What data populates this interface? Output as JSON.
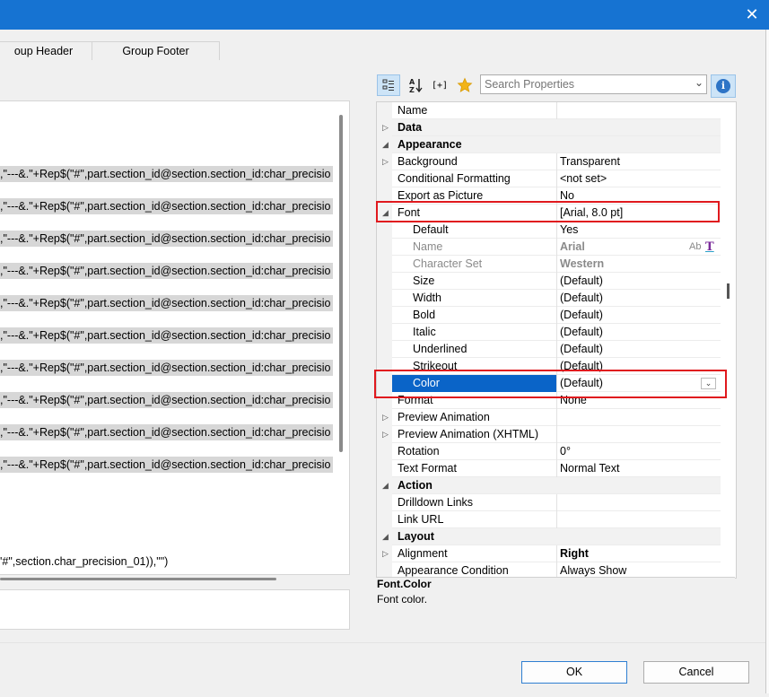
{
  "window": {
    "close_glyph": "✕"
  },
  "tabs": [
    {
      "label": "oup Header"
    },
    {
      "label": "Group Footer"
    }
  ],
  "editor": {
    "lines": [
      ",\"---&.\"+Rep$(\"#\",part.section_id@section.section_id:char_precisio",
      ",\"---&.\"+Rep$(\"#\",part.section_id@section.section_id:char_precisio",
      ",\"---&.\"+Rep$(\"#\",part.section_id@section.section_id:char_precisio",
      ",\"---&.\"+Rep$(\"#\",part.section_id@section.section_id:char_precisio",
      ",\"---&.\"+Rep$(\"#\",part.section_id@section.section_id:char_precisio",
      ",\"---&.\"+Rep$(\"#\",part.section_id@section.section_id:char_precisio",
      ",\"---&.\"+Rep$(\"#\",part.section_id@section.section_id:char_precisio",
      ",\"---&.\"+Rep$(\"#\",part.section_id@section.section_id:char_precisio",
      ",\"---&.\"+Rep$(\"#\",part.section_id@section.section_id:char_precisio",
      ",\"---&.\"+Rep$(\"#\",part.section_id@section.section_id:char_precisio"
    ],
    "last_line": "'#\",section.char_precision_01)),\"\")"
  },
  "toolbar": {
    "search_placeholder": "Search Properties",
    "info_glyph": "i",
    "expr_label": "[+]"
  },
  "properties": [
    {
      "type": "prop",
      "name": "Name",
      "value": ""
    },
    {
      "type": "cat",
      "name": "Data",
      "expander": "▷"
    },
    {
      "type": "cat",
      "name": "Appearance",
      "expander": "◢"
    },
    {
      "type": "prop",
      "name": "Background",
      "value": "Transparent",
      "expander": "▷"
    },
    {
      "type": "prop",
      "name": "Conditional Formatting",
      "value": "<not set>"
    },
    {
      "type": "prop",
      "name": "Export as Picture",
      "value": "No"
    },
    {
      "type": "prop",
      "name": "Font",
      "value": "[Arial, 8.0 pt]",
      "expander": "◢"
    },
    {
      "type": "sub",
      "name": "Default",
      "value": "Yes"
    },
    {
      "type": "subgrey",
      "name": "Name",
      "value": "Arial"
    },
    {
      "type": "subgrey",
      "name": "Character Set",
      "value": "Western"
    },
    {
      "type": "sub",
      "name": "Size",
      "value": "(Default)"
    },
    {
      "type": "sub",
      "name": "Width",
      "value": "(Default)"
    },
    {
      "type": "sub",
      "name": "Bold",
      "value": "(Default)"
    },
    {
      "type": "sub",
      "name": "Italic",
      "value": "(Default)"
    },
    {
      "type": "sub",
      "name": "Underlined",
      "value": "(Default)"
    },
    {
      "type": "sub",
      "name": "Strikeout",
      "value": "(Default)"
    },
    {
      "type": "selected",
      "name": "Color",
      "value": "(Default)"
    },
    {
      "type": "prop",
      "name": "Format",
      "value": "None"
    },
    {
      "type": "prop",
      "name": "Preview Animation",
      "value": "",
      "expander": "▷"
    },
    {
      "type": "prop",
      "name": "Preview Animation (XHTML)",
      "value": "",
      "expander": "▷"
    },
    {
      "type": "prop",
      "name": "Rotation",
      "value": "0°"
    },
    {
      "type": "prop",
      "name": "Text Format",
      "value": "Normal Text"
    },
    {
      "type": "cat",
      "name": "Action",
      "expander": "◢"
    },
    {
      "type": "prop",
      "name": "Drilldown Links",
      "value": ""
    },
    {
      "type": "prop",
      "name": "Link URL",
      "value": ""
    },
    {
      "type": "cat",
      "name": "Layout",
      "expander": "◢"
    },
    {
      "type": "prop",
      "name": "Alignment",
      "value": "Right",
      "expander": "▷",
      "bold": true
    },
    {
      "type": "prop",
      "name": "Appearance Condition",
      "value": "Always Show"
    }
  ],
  "font_name_icons": {
    "ab": "Ab",
    "font": "T"
  },
  "description": {
    "title": "Font.Color",
    "text": "Font color."
  },
  "buttons": {
    "ok": "OK",
    "cancel": "Cancel"
  },
  "colors": {
    "titlebar": "#1673d2",
    "selection": "#0a64c8",
    "highlight_box": "#e0191e"
  }
}
